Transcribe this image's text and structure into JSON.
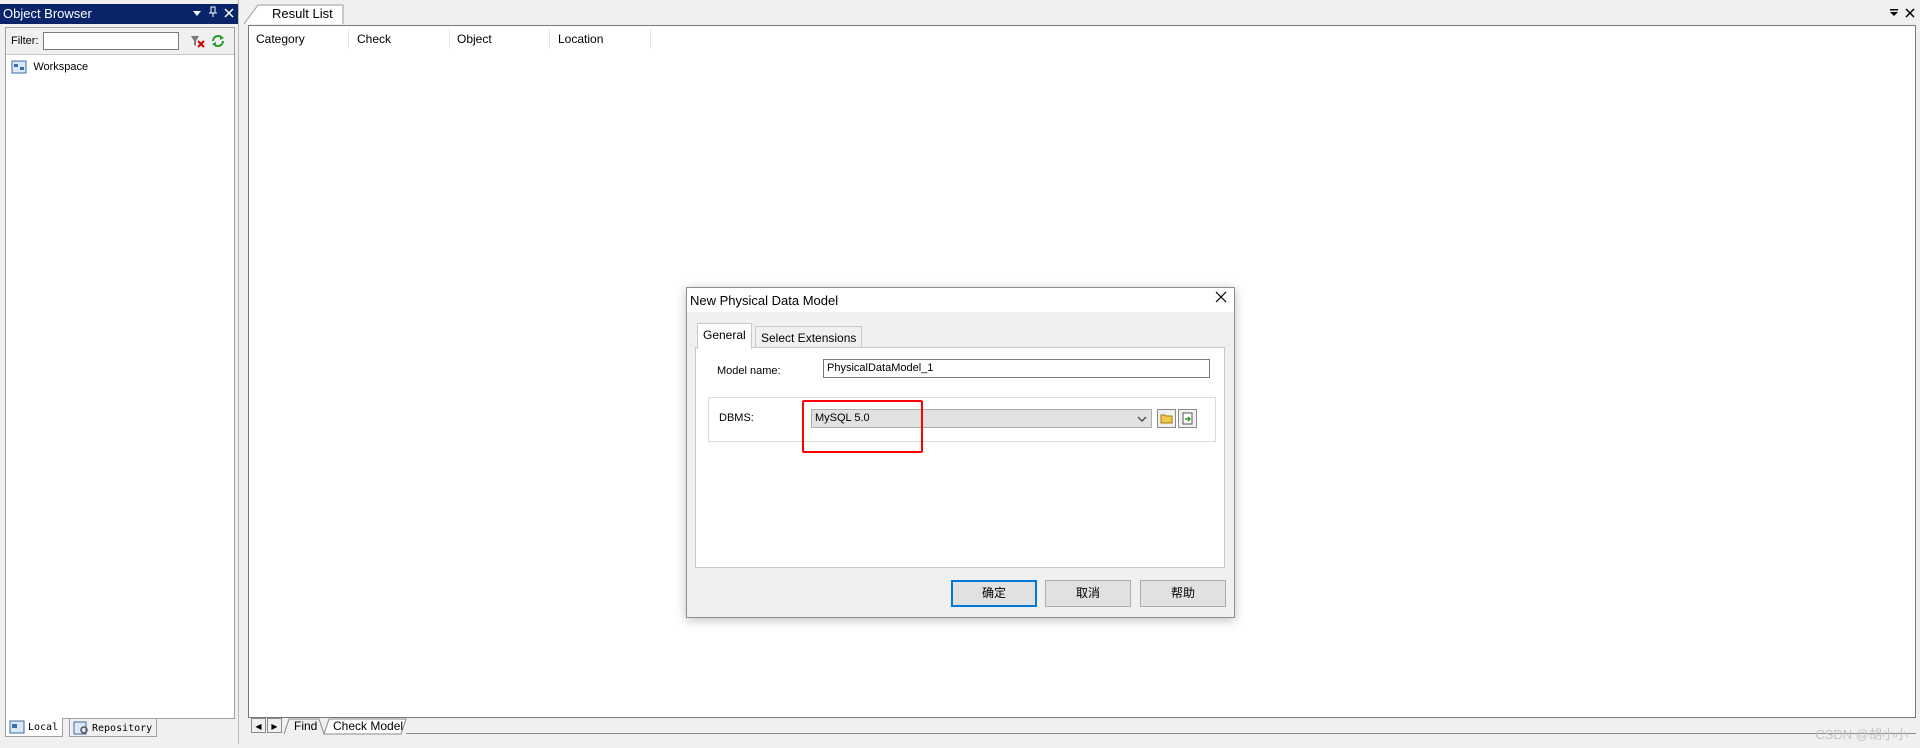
{
  "object_browser": {
    "title": "Object Browser",
    "filter_label": "Filter:",
    "filter_value": "",
    "tree": [
      "Workspace"
    ],
    "tabs": [
      "Local",
      "Repository"
    ]
  },
  "result_list": {
    "tab_title": "Result List",
    "columns": [
      "Category",
      "Check",
      "Object",
      "Location"
    ],
    "bottom_tabs": [
      "Find",
      "Check Model"
    ]
  },
  "dialog": {
    "title": "New Physical Data Model",
    "tabs": [
      "General",
      "Select Extensions"
    ],
    "model_name_label": "Model name:",
    "model_name_value": "PhysicalDataModel_1",
    "dbms_label": "DBMS:",
    "dbms_value": "MySQL 5.0",
    "buttons": {
      "ok": "确定",
      "cancel": "取消",
      "help": "帮助"
    }
  },
  "watermark": "CSDN @胡小小",
  "colors": {
    "titlebar": "#0a246a",
    "highlight": "#ff0000",
    "default_button_border": "#0078d7"
  }
}
